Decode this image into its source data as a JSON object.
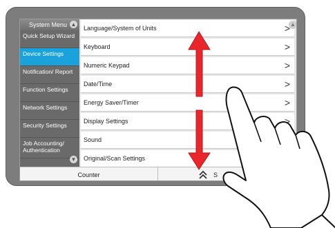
{
  "sidebar": {
    "title": "System Menu",
    "items": [
      {
        "label": "Quick Setup Wizard"
      },
      {
        "label": "Device Settings"
      },
      {
        "label": "Notification/ Report"
      },
      {
        "label": "Function Settings"
      },
      {
        "label": "Network Settings"
      },
      {
        "label": "Security Settings"
      },
      {
        "label": "Job Accounting/ Authentication"
      }
    ]
  },
  "list": {
    "rows": [
      {
        "label": "Language/System of Units",
        "chevron": ">"
      },
      {
        "label": "Keyboard",
        "chevron": ">"
      },
      {
        "label": "Numeric Keypad",
        "chevron": ">"
      },
      {
        "label": "Date/Time",
        "chevron": ">"
      },
      {
        "label": "Energy Saver/Timer",
        "chevron": ">"
      },
      {
        "label": "Display Settings",
        "chevron": ">"
      },
      {
        "label": "Sound",
        "chevron": ">"
      },
      {
        "label": "Original/Scan Settings",
        "chevron": ">"
      }
    ]
  },
  "bottom_bar": {
    "counter_label": "Counter",
    "status_label": "S"
  },
  "colors": {
    "active_item": "#1aa2dd",
    "arrow": "#e8262b"
  }
}
